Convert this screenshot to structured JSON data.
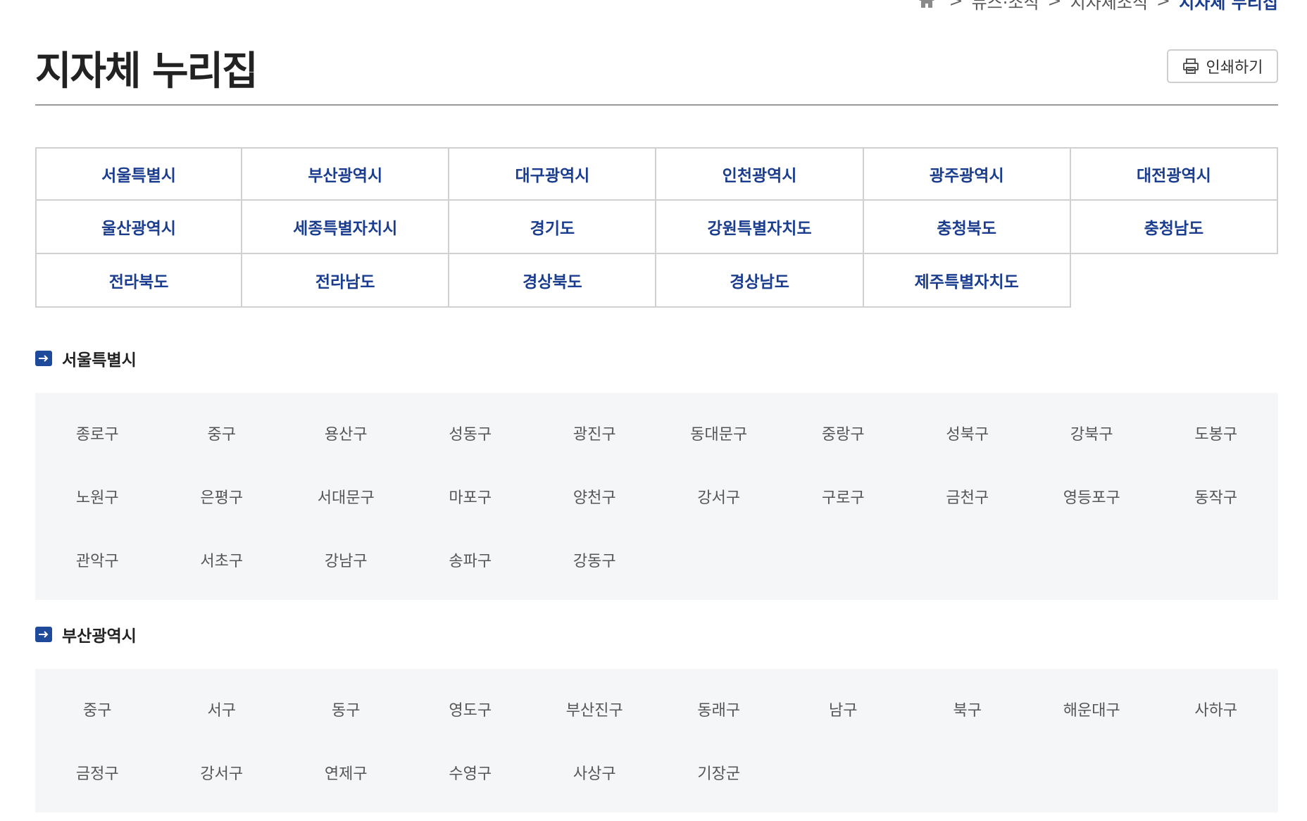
{
  "breadcrumb": {
    "items": [
      "뉴스·소식",
      "지자체소식"
    ],
    "current": "지자체 누리집",
    "separator": ">"
  },
  "page": {
    "title": "지자체 누리집",
    "print_label": "인쇄하기"
  },
  "regions": [
    "서울특별시",
    "부산광역시",
    "대구광역시",
    "인천광역시",
    "광주광역시",
    "대전광역시",
    "울산광역시",
    "세종특별자치시",
    "경기도",
    "강원특별자치도",
    "충청북도",
    "충청남도",
    "전라북도",
    "전라남도",
    "경상북도",
    "경상남도",
    "제주특별자치도"
  ],
  "sections": [
    {
      "title": "서울특별시",
      "districts": [
        "종로구",
        "중구",
        "용산구",
        "성동구",
        "광진구",
        "동대문구",
        "중랑구",
        "성북구",
        "강북구",
        "도봉구",
        "노원구",
        "은평구",
        "서대문구",
        "마포구",
        "양천구",
        "강서구",
        "구로구",
        "금천구",
        "영등포구",
        "동작구",
        "관악구",
        "서초구",
        "강남구",
        "송파구",
        "강동구"
      ]
    },
    {
      "title": "부산광역시",
      "districts": [
        "중구",
        "서구",
        "동구",
        "영도구",
        "부산진구",
        "동래구",
        "남구",
        "북구",
        "해운대구",
        "사하구",
        "금정구",
        "강서구",
        "연제구",
        "수영구",
        "사상구",
        "기장군"
      ]
    }
  ],
  "colors": {
    "accent": "#1a3d8f",
    "section_icon": "#1f4a9c",
    "district_bg": "#f5f6f8",
    "border": "#d0d0d0"
  },
  "icons": {
    "home": "home-icon",
    "print": "printer-icon",
    "section": "arrow-right-icon"
  }
}
